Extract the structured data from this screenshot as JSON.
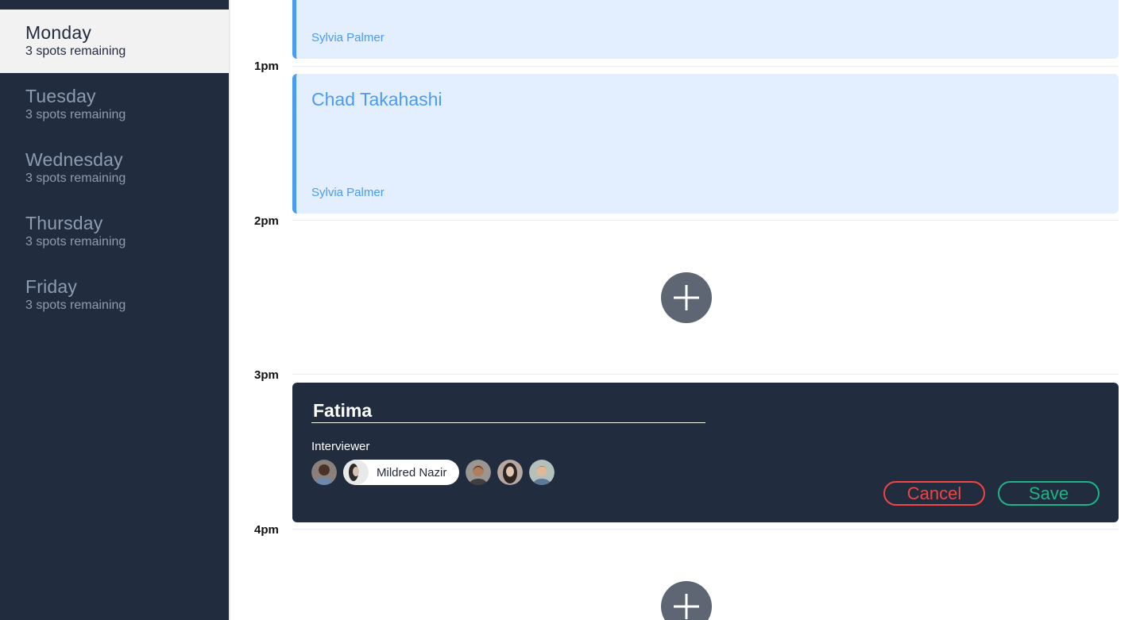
{
  "sidebar": {
    "days": [
      {
        "name": "Monday",
        "spots": "3 spots remaining",
        "active": true
      },
      {
        "name": "Tuesday",
        "spots": "3 spots remaining",
        "active": false
      },
      {
        "name": "Wednesday",
        "spots": "3 spots remaining",
        "active": false
      },
      {
        "name": "Thursday",
        "spots": "3 spots remaining",
        "active": false
      },
      {
        "name": "Friday",
        "spots": "3 spots remaining",
        "active": false
      }
    ]
  },
  "schedule": {
    "hours": [
      "1pm",
      "2pm",
      "3pm",
      "4pm"
    ],
    "events": [
      {
        "title": "",
        "interviewer": "Sylvia Palmer"
      },
      {
        "title": "Chad Takahashi",
        "interviewer": "Sylvia Palmer"
      }
    ],
    "add_icon": "plus-icon"
  },
  "editor": {
    "name_value": "Fatima",
    "interviewer_label": "Interviewer",
    "selected_interviewer": "Mildred Nazir",
    "cancel_label": "Cancel",
    "save_label": "Save"
  },
  "colors": {
    "sidebar_bg": "#212d3f",
    "event_bg": "#e3effe",
    "event_accent": "#4a9bf5",
    "cancel": "#f04545",
    "save": "#1eb486",
    "add_button": "#5e6673"
  }
}
